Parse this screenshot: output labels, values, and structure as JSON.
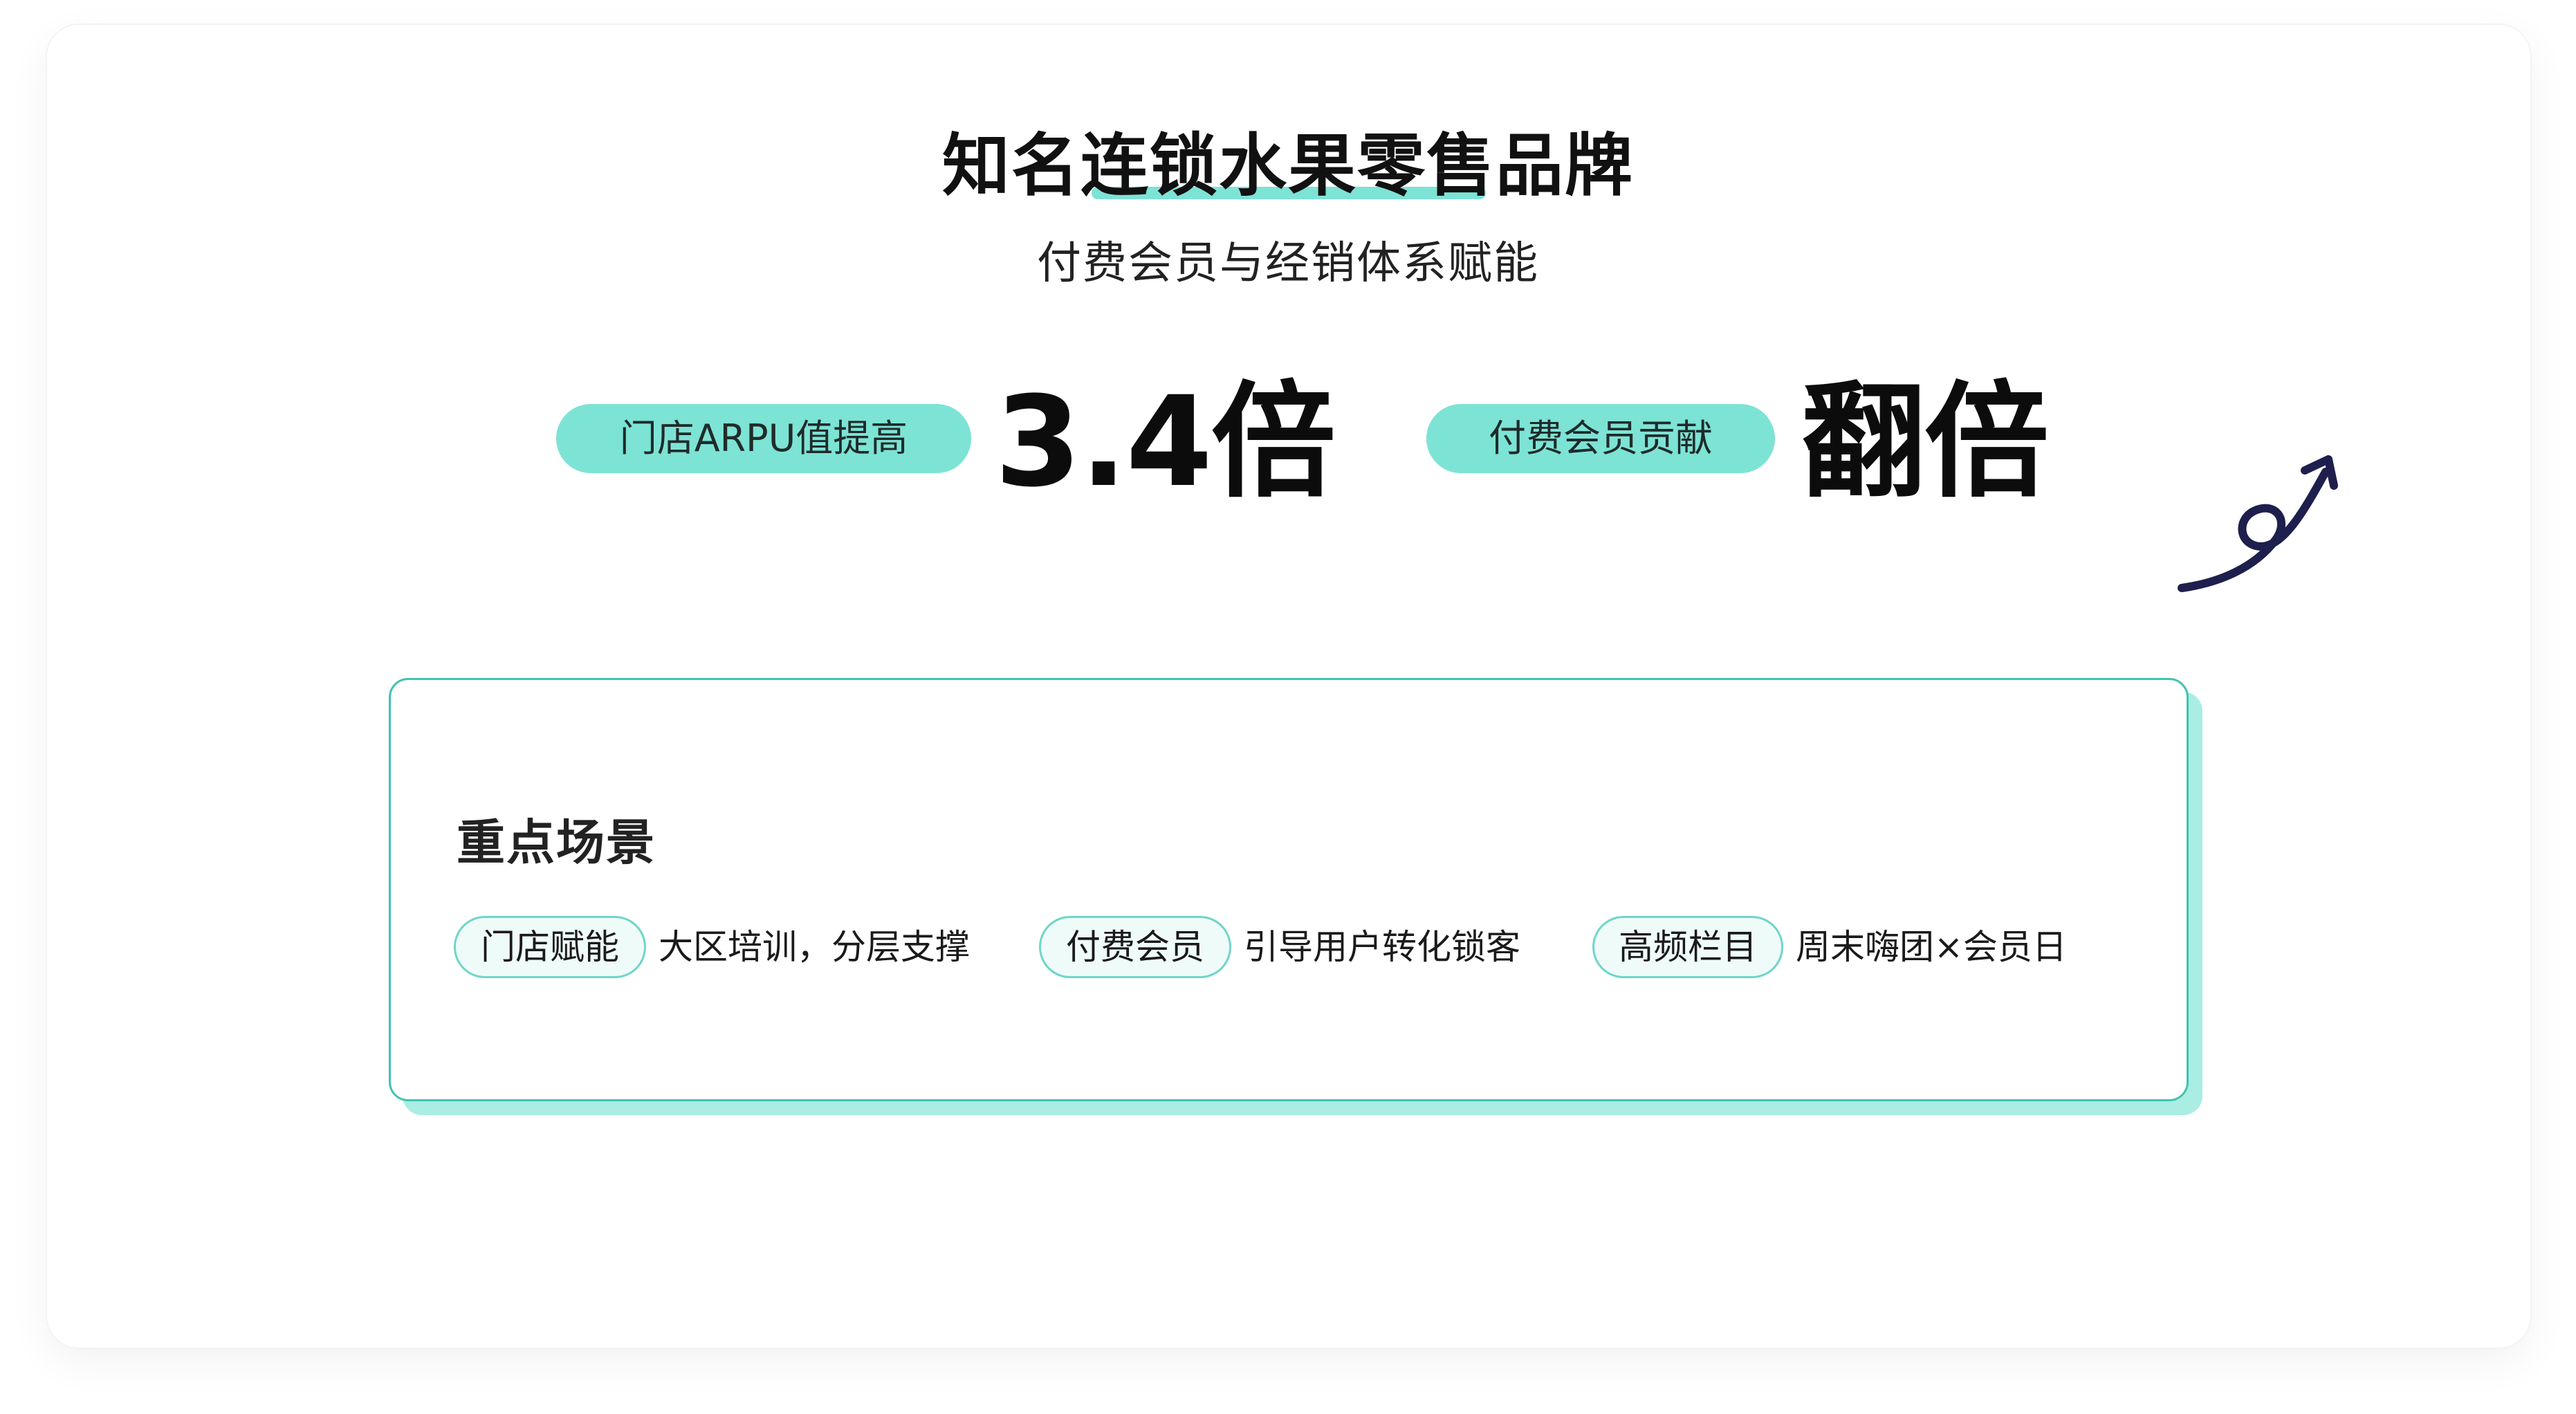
{
  "header": {
    "title": "知名连锁水果零售品牌",
    "subtitle": "付费会员与经销体系赋能"
  },
  "stats": [
    {
      "label": "门店ARPU值提高",
      "value": "3.4倍"
    },
    {
      "label": "付费会员贡献",
      "value": "翻倍"
    }
  ],
  "scenes": {
    "title": "重点场景",
    "items": [
      {
        "tag": "门店赋能",
        "desc": "大区培训，分层支撑"
      },
      {
        "tag": "付费会员",
        "desc": "引导用户转化锁客"
      },
      {
        "tag": "高频栏目",
        "desc": "周末嗨团×会员日"
      }
    ]
  },
  "colors": {
    "accent": "#7de3d5",
    "panel_border": "#40c2b4",
    "panel_shadow": "#a9ede3",
    "arrow": "#1e1f4d"
  },
  "icons": {
    "growth_arrow": "curly-up-arrow-icon"
  }
}
